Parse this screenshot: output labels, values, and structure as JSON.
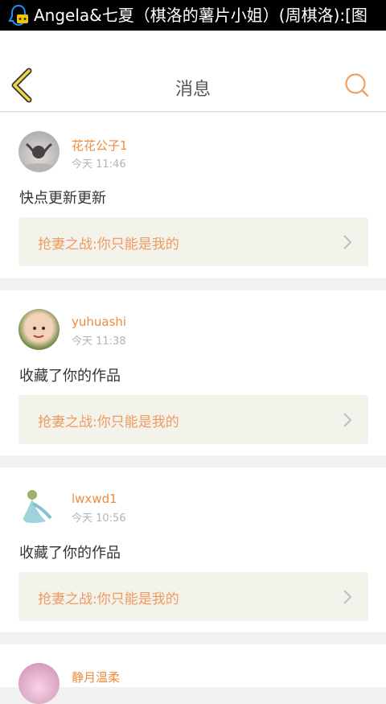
{
  "statusbar": {
    "text": "Angela&七夏（棋洛的薯片小姐）(周棋洛):[图",
    "icon": "qq-penguin-icon"
  },
  "header": {
    "title": "消息",
    "back_icon": "chevron-left-icon",
    "search_icon": "search-icon"
  },
  "accent": "#f08a3d",
  "messages": [
    {
      "user": "花花公子1",
      "time": "今天 11:46",
      "text": "快点更新更新",
      "work": "抢妻之战:你只能是我的"
    },
    {
      "user": "yuhuashi",
      "time": "今天 11:38",
      "text": "收藏了你的作品",
      "work": "抢妻之战:你只能是我的"
    },
    {
      "user": "lwxwd1",
      "time": "今天 10:56",
      "text": "收藏了你的作品",
      "work": "抢妻之战:你只能是我的"
    },
    {
      "user": "静月温柔"
    }
  ]
}
